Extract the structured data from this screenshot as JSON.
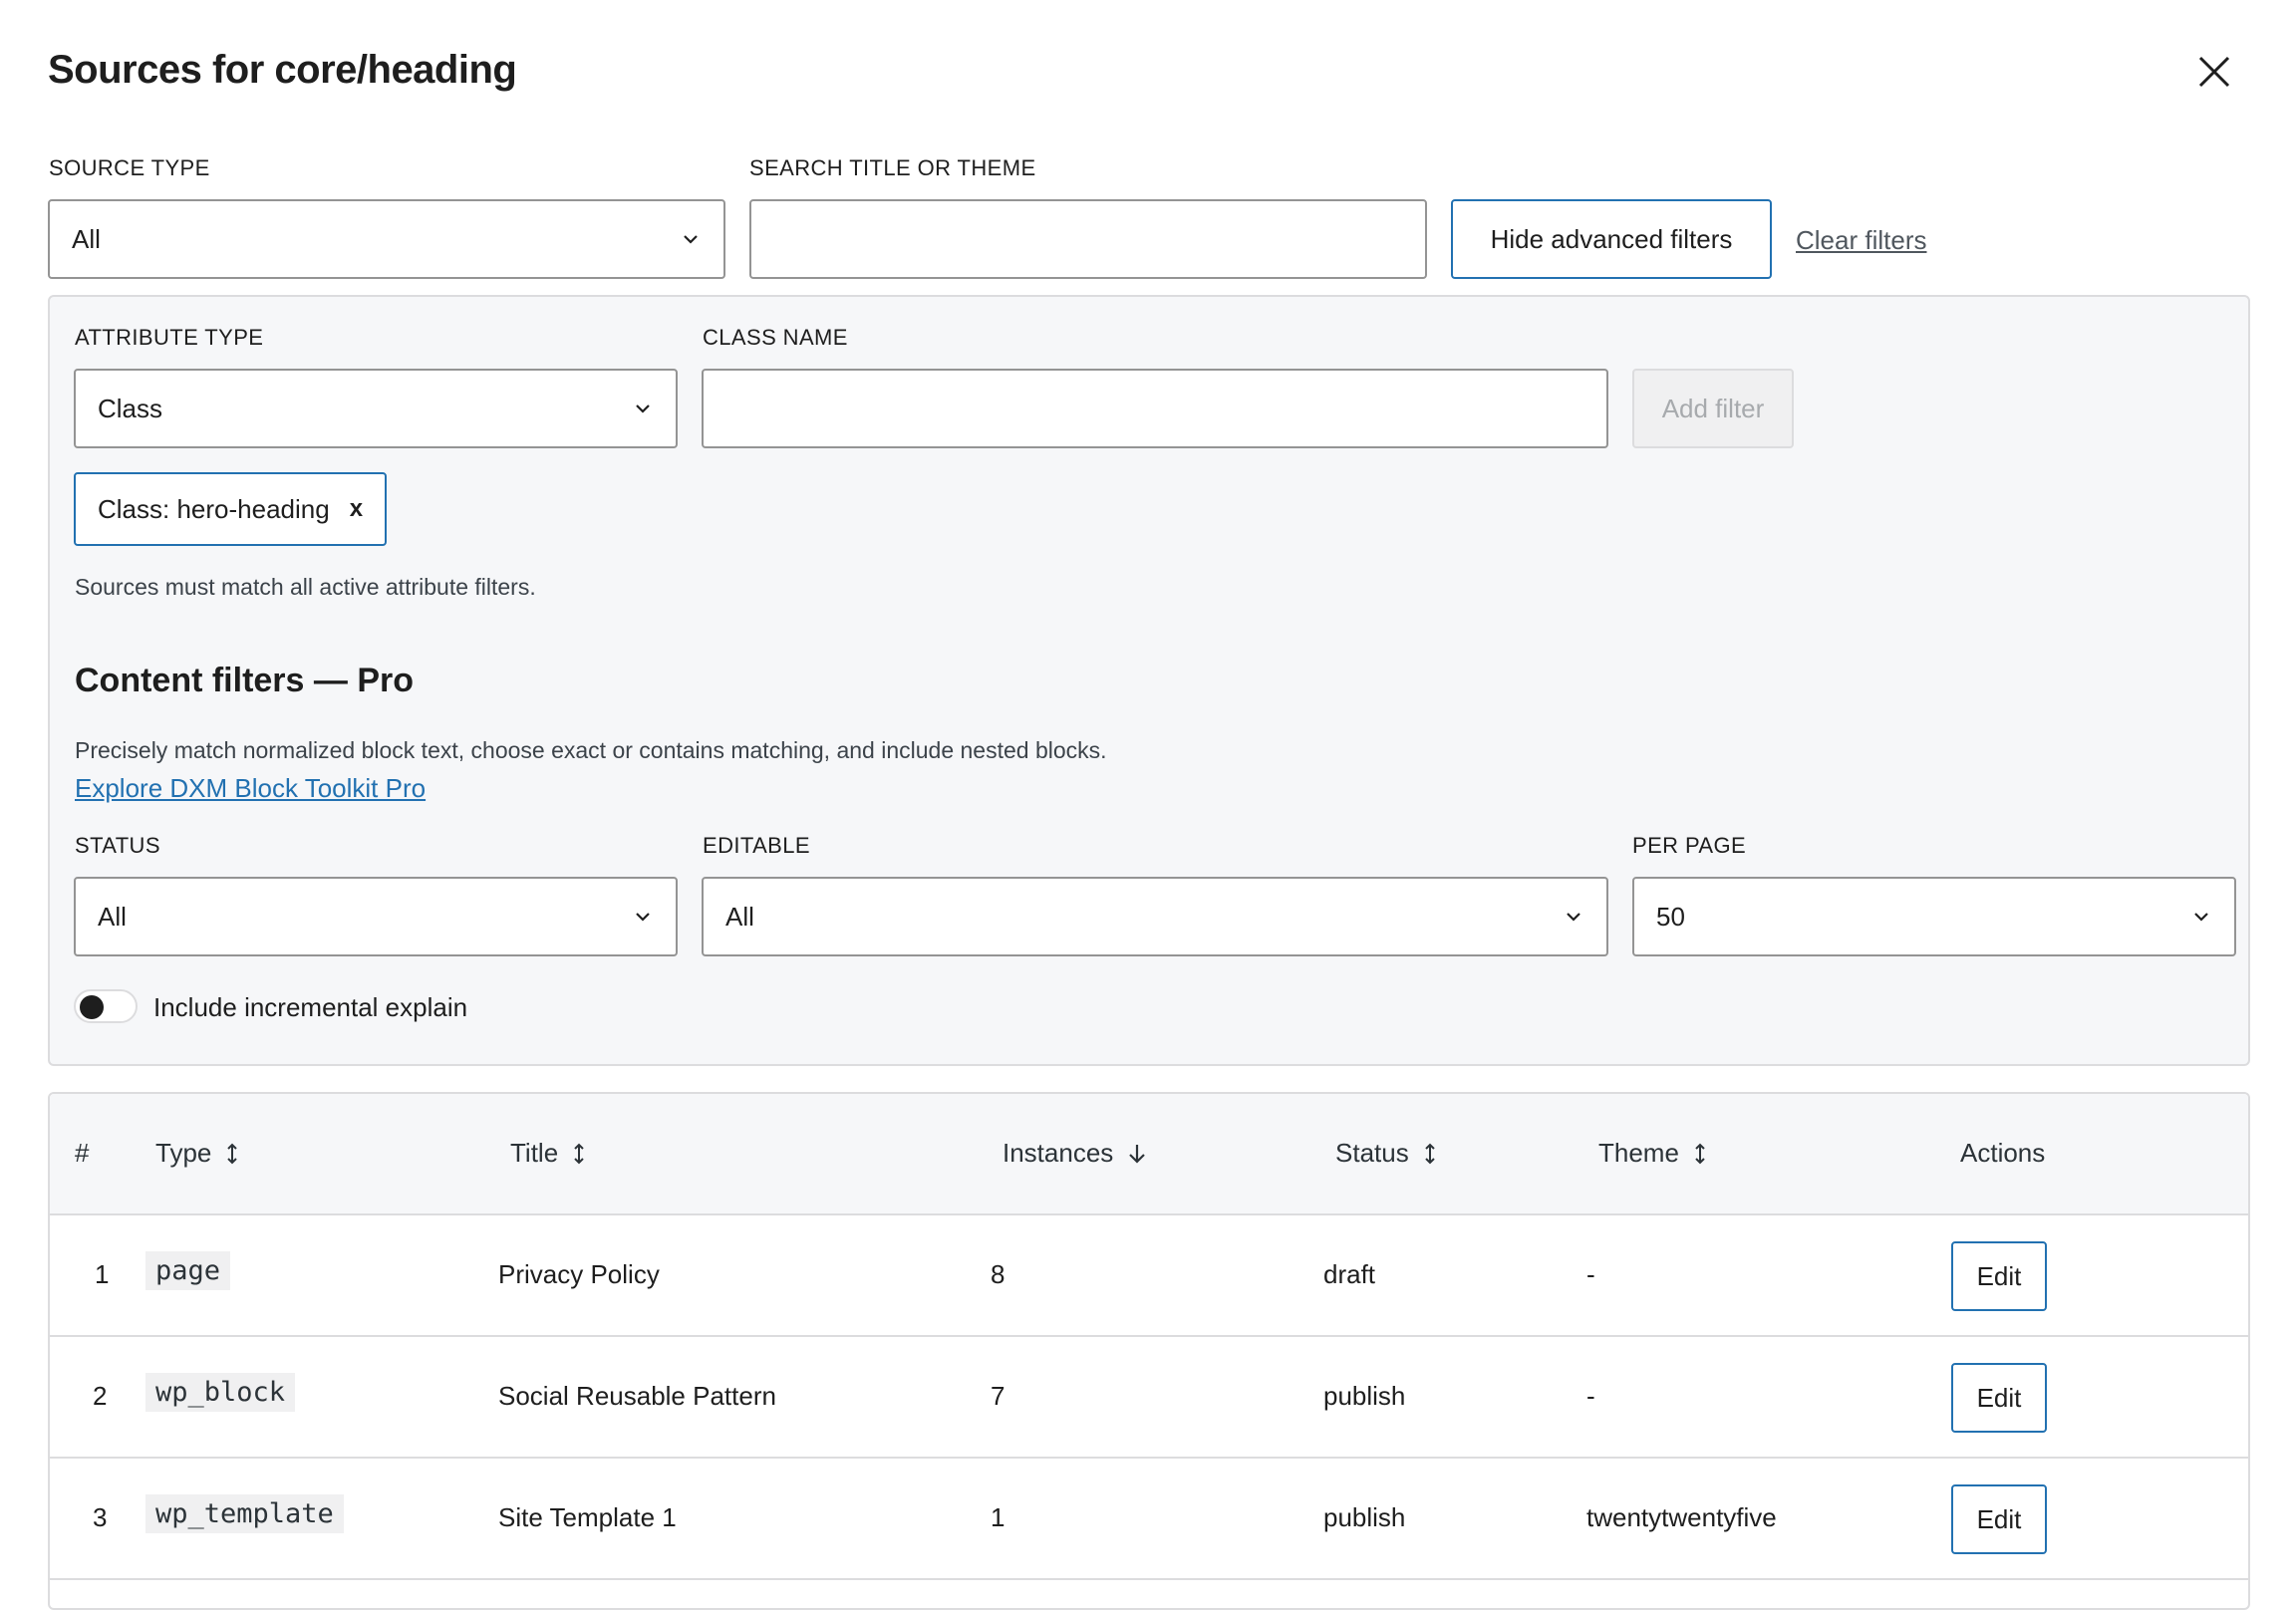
{
  "modal": {
    "title": "Sources for core/heading"
  },
  "filters": {
    "source_type": {
      "label": "SOURCE TYPE",
      "value": "All"
    },
    "search": {
      "label": "SEARCH TITLE OR THEME",
      "value": "",
      "placeholder": ""
    },
    "toggle_advanced_label": "Hide advanced filters",
    "clear_label": "Clear filters"
  },
  "advanced": {
    "attribute_type": {
      "label": "ATTRIBUTE TYPE",
      "value": "Class"
    },
    "class_name": {
      "label": "CLASS NAME",
      "value": ""
    },
    "add_filter_label": "Add filter",
    "active_chip": {
      "label": "Class: hero-heading",
      "remove": "x"
    },
    "help_text": "Sources must match all active attribute filters.",
    "content_filters": {
      "title": "Content filters — Pro",
      "description": "Precisely match normalized block text, choose exact or contains matching, and include nested blocks.",
      "link": "Explore DXM Block Toolkit Pro"
    },
    "status": {
      "label": "STATUS",
      "value": "All"
    },
    "editable": {
      "label": "EDITABLE",
      "value": "All"
    },
    "per_page": {
      "label": "PER PAGE",
      "value": "50"
    },
    "toggle": {
      "label": "Include incremental explain",
      "on": false
    }
  },
  "table": {
    "headers": {
      "index": "#",
      "type": "Type",
      "title": "Title",
      "instances": "Instances",
      "status": "Status",
      "theme": "Theme",
      "actions": "Actions"
    },
    "rows": [
      {
        "index": "1",
        "type": "page",
        "title": "Privacy Policy",
        "instances": "8",
        "status": "draft",
        "theme": "-",
        "action": "Edit"
      },
      {
        "index": "2",
        "type": "wp_block",
        "title": "Social Reusable Pattern",
        "instances": "7",
        "status": "publish",
        "theme": "-",
        "action": "Edit"
      },
      {
        "index": "3",
        "type": "wp_template",
        "title": "Site Template 1",
        "instances": "1",
        "status": "publish",
        "theme": "twentytwentyfive",
        "action": "Edit"
      }
    ]
  },
  "colors": {
    "accent": "#2271b1",
    "panel_bg": "#f6f7f9",
    "border": "#dcdcde"
  },
  "icons": {
    "close": "close-icon",
    "select": "chevron-down-icon",
    "sort": "sort-icon",
    "sort_desc": "arrow-down-icon"
  }
}
